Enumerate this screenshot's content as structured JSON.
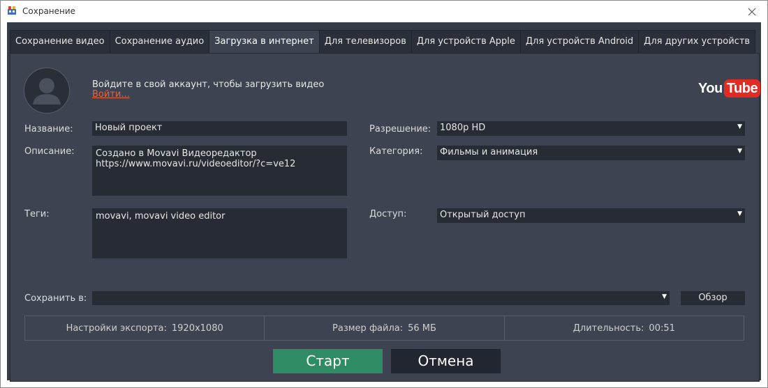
{
  "window": {
    "title": "Сохранение",
    "close_icon": "close-icon"
  },
  "tabs": [
    {
      "label": "Сохранение видео",
      "active": false
    },
    {
      "label": "Сохранение аудио",
      "active": false
    },
    {
      "label": "Загрузка в интернет",
      "active": true
    },
    {
      "label": "Для телевизоров",
      "active": false
    },
    {
      "label": "Для устройств Apple",
      "active": false
    },
    {
      "label": "Для устройств Android",
      "active": false
    },
    {
      "label": "Для других устройств",
      "active": false
    }
  ],
  "account": {
    "prompt": "Войдите в свой аккаунт, чтобы загрузить видео",
    "login_link": "Войти..."
  },
  "service_logo": {
    "you": "You",
    "tube": "Tube",
    "color": "#e32b24"
  },
  "form": {
    "name_label": "Название:",
    "name_value": "Новый проект",
    "description_label": "Описание:",
    "description_value": "Создано в Movavi Видеоредактор\nhttps://www.movavi.ru/videoeditor/?c=ve12",
    "tags_label": "Теги:",
    "tags_value": "movavi, movavi video editor",
    "resolution_label": "Разрешение:",
    "resolution_value": "1080p HD",
    "category_label": "Категория:",
    "category_value": "Фильмы и анимация",
    "access_label": "Доступ:",
    "access_value": "Открытый доступ",
    "save_to_label": "Сохранить в:",
    "save_to_value": "",
    "browse_label": "Обзор"
  },
  "info": {
    "export_label": "Настройки экспорта:",
    "export_value": "1920x1080",
    "size_label": "Размер файла:",
    "size_value": "56 МБ",
    "duration_label": "Длительность:",
    "duration_value": "00:51"
  },
  "actions": {
    "start_label": "Старт",
    "cancel_label": "Отмена"
  },
  "colors": {
    "background": "#353b47",
    "panel": "#3d4350",
    "field": "#272b33",
    "start": "#2f8c64",
    "cancel": "#222630",
    "link": "#e5653d"
  }
}
